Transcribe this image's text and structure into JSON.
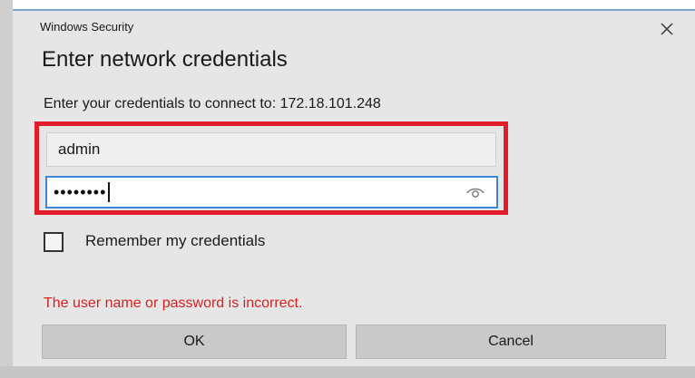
{
  "dialog": {
    "window_title": "Windows Security",
    "heading": "Enter network credentials",
    "prompt": "Enter your credentials to connect to: 172.18.101.248",
    "username_value": "admin",
    "password_masked": "••••••••",
    "remember_label": "Remember my credentials",
    "remember_checked": false,
    "error_message": "The user name or password is incorrect.",
    "ok_label": "OK",
    "cancel_label": "Cancel"
  },
  "icons": {
    "close": "close-icon",
    "reveal_password": "eye-icon"
  },
  "colors": {
    "dialog_background": "#e6e6e6",
    "highlight_border": "#e21c2b",
    "password_focus_border": "#3f84d6",
    "error_text": "#d22222",
    "button_background": "#c9c9c9"
  }
}
